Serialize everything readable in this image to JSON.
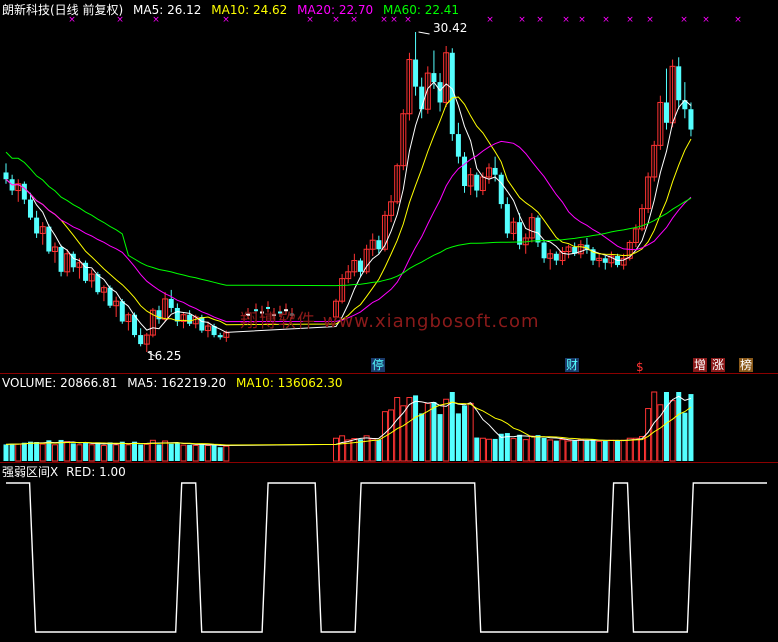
{
  "header": {
    "title": "朗新科技(日线 前复权)",
    "ma5": "MA5: 26.12",
    "ma10": "MA10: 24.62",
    "ma20": "MA20: 22.70",
    "ma60": "MA60: 22.41"
  },
  "volume_header": {
    "volume": "VOLUME: 20866.81",
    "ma5": "MA5: 162219.20",
    "ma10": "MA10: 136062.30"
  },
  "indicator_header": {
    "name": "强弱区间X",
    "red": "RED: 1.00"
  },
  "watermark": "翔博软件 www.xiangbosoft.com",
  "markers": {
    "ting": "停",
    "cai": "财",
    "dollar": "$",
    "zeng": "增",
    "zhang": "涨",
    "bang": "榜"
  },
  "colors": {
    "up": "#ff3333",
    "down": "#54ffff",
    "ma5": "#ffffff",
    "ma10": "#ffff00",
    "ma20": "#ff00ff",
    "ma60": "#00ff00",
    "background": "#000000",
    "grid_border": "#8b0000"
  },
  "chart_data": [
    {
      "type": "candlestick",
      "title": "朗新科技(日线 前复权)",
      "annotations": [
        {
          "label": "30.42",
          "value": 30.42,
          "kind": "high"
        },
        {
          "label": "16.25",
          "value": 16.25,
          "kind": "low"
        }
      ],
      "ohlc": [
        [
          24.2,
          24.6,
          23.7,
          23.9
        ],
        [
          23.9,
          24.1,
          23.2,
          23.4
        ],
        [
          23.4,
          23.9,
          22.9,
          23.7
        ],
        [
          23.7,
          23.8,
          22.8,
          23.0
        ],
        [
          23.0,
          23.3,
          22.1,
          22.2
        ],
        [
          22.2,
          22.5,
          21.3,
          21.5
        ],
        [
          21.5,
          22.0,
          21.0,
          21.8
        ],
        [
          21.8,
          21.9,
          20.6,
          20.7
        ],
        [
          20.7,
          21.1,
          20.2,
          20.9
        ],
        [
          20.9,
          21.0,
          19.6,
          19.8
        ],
        [
          19.8,
          20.8,
          19.6,
          20.6
        ],
        [
          20.6,
          20.7,
          19.8,
          20.0
        ],
        [
          20.0,
          20.4,
          19.5,
          20.2
        ],
        [
          20.2,
          20.3,
          19.3,
          19.4
        ],
        [
          19.4,
          19.9,
          19.1,
          19.7
        ],
        [
          19.7,
          19.8,
          18.8,
          18.9
        ],
        [
          18.9,
          19.2,
          18.5,
          19.1
        ],
        [
          19.1,
          19.2,
          18.2,
          18.3
        ],
        [
          18.3,
          18.7,
          17.8,
          18.5
        ],
        [
          18.5,
          18.6,
          17.5,
          17.6
        ],
        [
          17.6,
          18.0,
          17.2,
          17.9
        ],
        [
          17.9,
          18.0,
          16.9,
          17.0
        ],
        [
          17.0,
          17.3,
          16.5,
          16.6
        ],
        [
          16.6,
          17.1,
          16.25,
          17.0
        ],
        [
          17.0,
          18.2,
          16.9,
          18.1
        ],
        [
          18.1,
          18.3,
          17.5,
          17.7
        ],
        [
          17.7,
          18.9,
          17.6,
          18.6
        ],
        [
          18.6,
          19.0,
          18.0,
          18.2
        ],
        [
          18.2,
          18.4,
          17.4,
          17.6
        ],
        [
          17.6,
          18.0,
          17.3,
          17.9
        ],
        [
          17.9,
          18.1,
          17.4,
          17.5
        ],
        [
          17.5,
          17.9,
          17.3,
          17.8
        ],
        [
          17.8,
          17.9,
          17.1,
          17.2
        ],
        [
          17.2,
          17.6,
          16.9,
          17.4
        ],
        [
          17.4,
          17.5,
          16.9,
          17.0
        ],
        [
          17.0,
          17.1,
          16.8,
          16.9
        ],
        [
          16.9,
          17.2,
          16.7,
          17.1
        ]
      ],
      "ohlc_after_gap": [
        [
          17.8,
          18.6,
          17.7,
          18.5
        ],
        [
          18.5,
          19.7,
          18.4,
          19.5
        ],
        [
          19.5,
          20.1,
          19.3,
          19.8
        ],
        [
          19.8,
          20.6,
          19.6,
          20.3
        ],
        [
          20.3,
          20.4,
          19.6,
          19.8
        ],
        [
          19.8,
          21.0,
          19.7,
          20.8
        ],
        [
          20.8,
          21.5,
          20.5,
          21.2
        ],
        [
          21.2,
          21.4,
          20.6,
          20.8
        ],
        [
          20.8,
          22.5,
          20.7,
          22.3
        ],
        [
          22.3,
          23.2,
          22.0,
          22.9
        ],
        [
          22.9,
          24.6,
          22.8,
          24.5
        ],
        [
          24.5,
          27.0,
          24.3,
          26.8
        ],
        [
          26.8,
          29.5,
          26.5,
          29.2
        ],
        [
          29.2,
          30.42,
          27.6,
          28.0
        ],
        [
          28.0,
          28.4,
          26.6,
          27.0
        ],
        [
          27.0,
          28.9,
          26.8,
          28.6
        ],
        [
          28.6,
          29.6,
          27.9,
          28.2
        ],
        [
          28.2,
          28.6,
          26.9,
          27.3
        ],
        [
          27.3,
          29.8,
          27.1,
          29.5
        ],
        [
          29.5,
          29.7,
          25.6,
          25.9
        ],
        [
          25.9,
          26.4,
          24.6,
          24.9
        ],
        [
          24.9,
          25.1,
          23.3,
          23.6
        ],
        [
          23.6,
          24.4,
          23.2,
          24.1
        ],
        [
          24.1,
          24.2,
          23.1,
          23.4
        ],
        [
          23.4,
          24.2,
          23.2,
          24.0
        ],
        [
          24.0,
          24.6,
          23.7,
          24.4
        ],
        [
          24.4,
          24.9,
          23.8,
          24.1
        ],
        [
          24.1,
          24.2,
          22.6,
          22.8
        ],
        [
          22.8,
          23.1,
          21.3,
          21.5
        ],
        [
          21.5,
          22.2,
          21.2,
          22.0
        ],
        [
          22.0,
          22.4,
          20.8,
          21.0
        ],
        [
          21.0,
          21.5,
          20.6,
          21.3
        ],
        [
          21.3,
          22.4,
          21.1,
          22.2
        ],
        [
          22.2,
          22.3,
          20.9,
          21.1
        ],
        [
          21.1,
          21.2,
          20.2,
          20.4
        ],
        [
          20.4,
          20.8,
          19.9,
          20.6
        ],
        [
          20.6,
          20.7,
          20.1,
          20.3
        ],
        [
          20.3,
          20.9,
          20.1,
          20.7
        ],
        [
          20.7,
          21.0,
          20.4,
          20.9
        ],
        [
          20.9,
          21.1,
          20.5,
          20.6
        ],
        [
          20.6,
          21.2,
          20.4,
          21.0
        ],
        [
          21.0,
          21.3,
          20.6,
          20.8
        ],
        [
          20.8,
          20.9,
          20.1,
          20.3
        ],
        [
          20.3,
          20.6,
          20.0,
          20.4
        ],
        [
          20.4,
          20.5,
          19.9,
          20.2
        ],
        [
          20.2,
          20.7,
          20.0,
          20.5
        ],
        [
          20.5,
          20.6,
          20.0,
          20.1
        ],
        [
          20.1,
          20.6,
          19.9,
          20.4
        ],
        [
          20.4,
          21.2,
          20.3,
          21.1
        ],
        [
          21.1,
          21.9,
          20.9,
          21.7
        ],
        [
          21.7,
          22.8,
          21.6,
          22.6
        ],
        [
          22.6,
          24.2,
          22.4,
          24.0
        ],
        [
          24.0,
          25.6,
          23.8,
          25.4
        ],
        [
          25.4,
          27.6,
          25.2,
          27.3
        ],
        [
          27.3,
          28.8,
          26.1,
          26.4
        ],
        [
          26.4,
          29.2,
          26.2,
          28.9
        ],
        [
          28.9,
          29.3,
          27.0,
          27.4
        ],
        [
          27.4,
          28.2,
          26.6,
          27.0
        ],
        [
          27.0,
          27.3,
          25.8,
          26.1
        ]
      ],
      "ma_latest": {
        "MA5": 26.12,
        "MA10": 24.62,
        "MA20": 22.7,
        "MA60": 22.41
      }
    },
    {
      "type": "bar",
      "title": "VOLUME",
      "latest": {
        "VOLUME": 20866.81,
        "MA5": 162219.2,
        "MA10": 136062.3
      }
    },
    {
      "type": "line",
      "title": "强弱区间X",
      "latest": {
        "RED": 1.0
      },
      "ylim": [
        0,
        1
      ],
      "segments": [
        {
          "state": 1,
          "len": 4
        },
        {
          "state": 0,
          "len": 22
        },
        {
          "state": 1,
          "len": 3
        },
        {
          "state": 0,
          "len": 10
        },
        {
          "state": 1,
          "len": 8
        },
        {
          "state": 0,
          "len": 6
        },
        {
          "state": 1,
          "len": 18
        },
        {
          "state": 0,
          "len": 20
        },
        {
          "state": 1,
          "len": 3
        },
        {
          "state": 0,
          "len": 9
        },
        {
          "state": 1,
          "len": 12
        }
      ]
    }
  ]
}
